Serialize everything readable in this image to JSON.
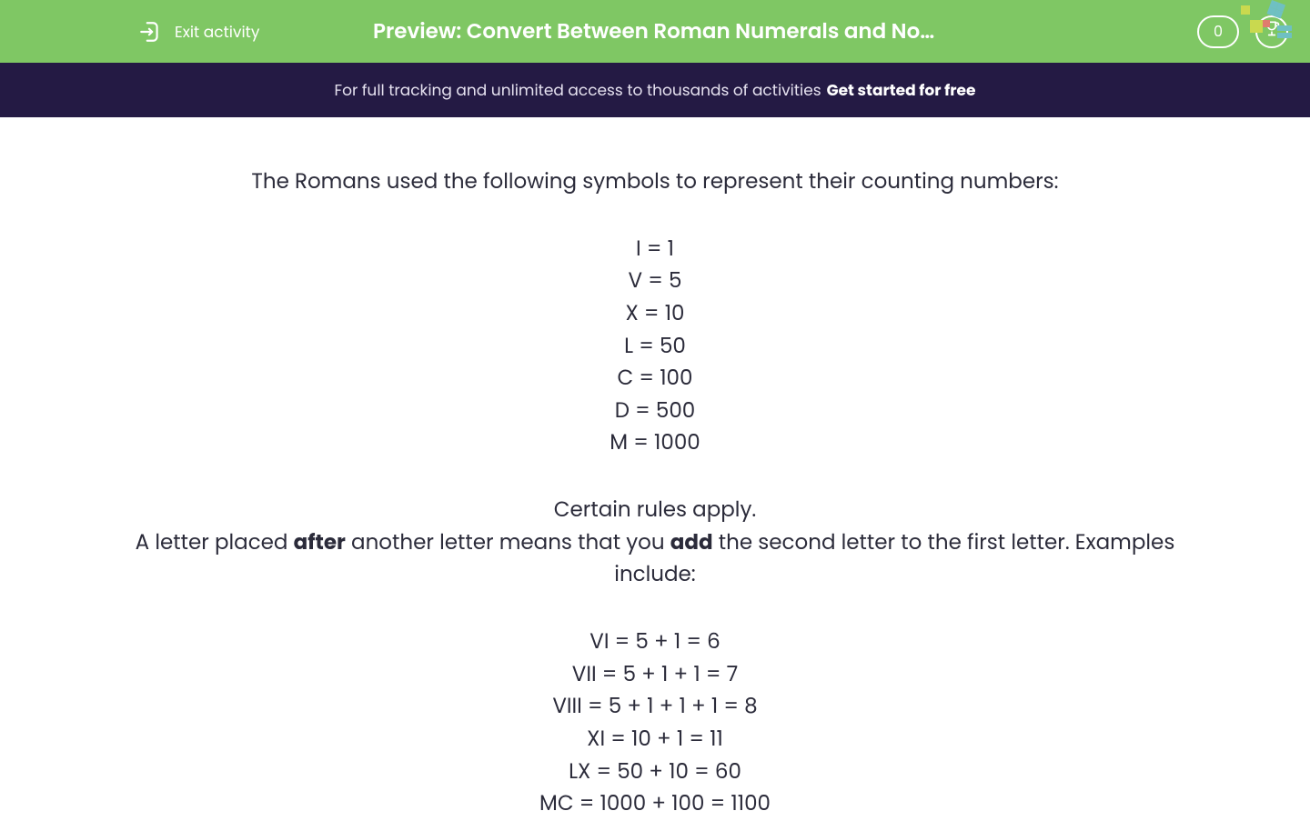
{
  "header": {
    "exit_label": "Exit activity",
    "title": "Preview: Convert Between Roman Numerals and Normal …",
    "score": "0",
    "trophy_icon": "trophy-icon",
    "exit_icon": "exit-icon"
  },
  "banner": {
    "text": "For full tracking and unlimited access to thousands of activities",
    "cta": "Get started for free"
  },
  "content": {
    "intro": "The Romans used the following symbols to represent their counting numbers:",
    "numerals": [
      "I = 1",
      "V = 5",
      "X = 10",
      "L = 50",
      "C = 100",
      "D = 500",
      "M = 1000"
    ],
    "rules_intro": "Certain rules apply.",
    "rule_add_1": "A letter placed ",
    "rule_add_bold1": "after",
    "rule_add_2": " another letter means that you ",
    "rule_add_bold2": "add",
    "rule_add_3": " the second letter to the first letter. Examples include: ",
    "examples": [
      "VI = 5 + 1 = 6",
      "VII = 5 + 1 + 1 = 7",
      "VIII = 5 + 1 + 1 + 1 = 8",
      "XI = 10 + 1 = 11",
      "LX = 50 + 10 = 60",
      "MC = 1000 + 100 = 1100"
    ]
  }
}
